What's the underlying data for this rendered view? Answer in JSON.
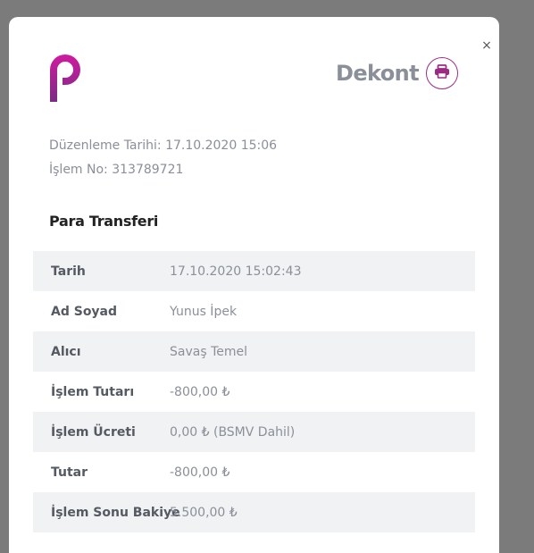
{
  "modal": {
    "title": "Dekont",
    "close_label": "×"
  },
  "meta": {
    "issue_date": "Düzenleme Tarihi: 17.10.2020 15:06",
    "transaction_no": "İşlem No: 313789721"
  },
  "section_title": "Para Transferi",
  "rows": [
    {
      "label": "Tarih",
      "value": "17.10.2020 15:02:43"
    },
    {
      "label": "Ad Soyad",
      "value": "Yunus İpek"
    },
    {
      "label": "Alıcı",
      "value": "Savaş Temel"
    },
    {
      "label": "İşlem Tutarı",
      "value": "-800,00 ₺"
    },
    {
      "label": "İşlem Ücreti",
      "value": "0,00 ₺ (BSMV Dahil)"
    },
    {
      "label": "Tutar",
      "value": "-800,00 ₺"
    },
    {
      "label": "İşlem Sonu Bakiye",
      "value": "5.500,00 ₺"
    }
  ],
  "icons": {
    "logo": "papara-logo",
    "print": "printer-icon",
    "close": "close-icon"
  },
  "colors": {
    "overlay": "#7b7b7b",
    "brand_magenta": "#c4129b",
    "brand_purple": "#7a2c84",
    "title_gray": "#8a8f99",
    "row_shade": "#f1f2f4"
  }
}
